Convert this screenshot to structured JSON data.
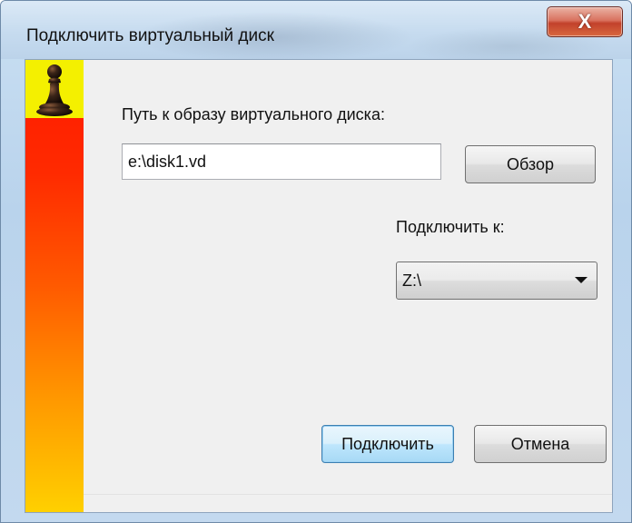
{
  "window": {
    "title": "Подключить виртуальный диск",
    "close_symbol": "X"
  },
  "banner": {
    "icon": "chess-pawn-icon",
    "colors": {
      "top": "#f4f000",
      "gradient_start": "#ff1a00",
      "gradient_end": "#ffd000"
    }
  },
  "form": {
    "path_label": "Путь к образу виртуального диска:",
    "path_value": "e:\\disk1.vd",
    "browse_label": "Обзор",
    "mount_label": "Подключить к:",
    "drive_selected": "Z:\\",
    "drive_options": [
      "Z:\\"
    ]
  },
  "footer": {
    "connect_label": "Подключить",
    "cancel_label": "Отмена"
  }
}
